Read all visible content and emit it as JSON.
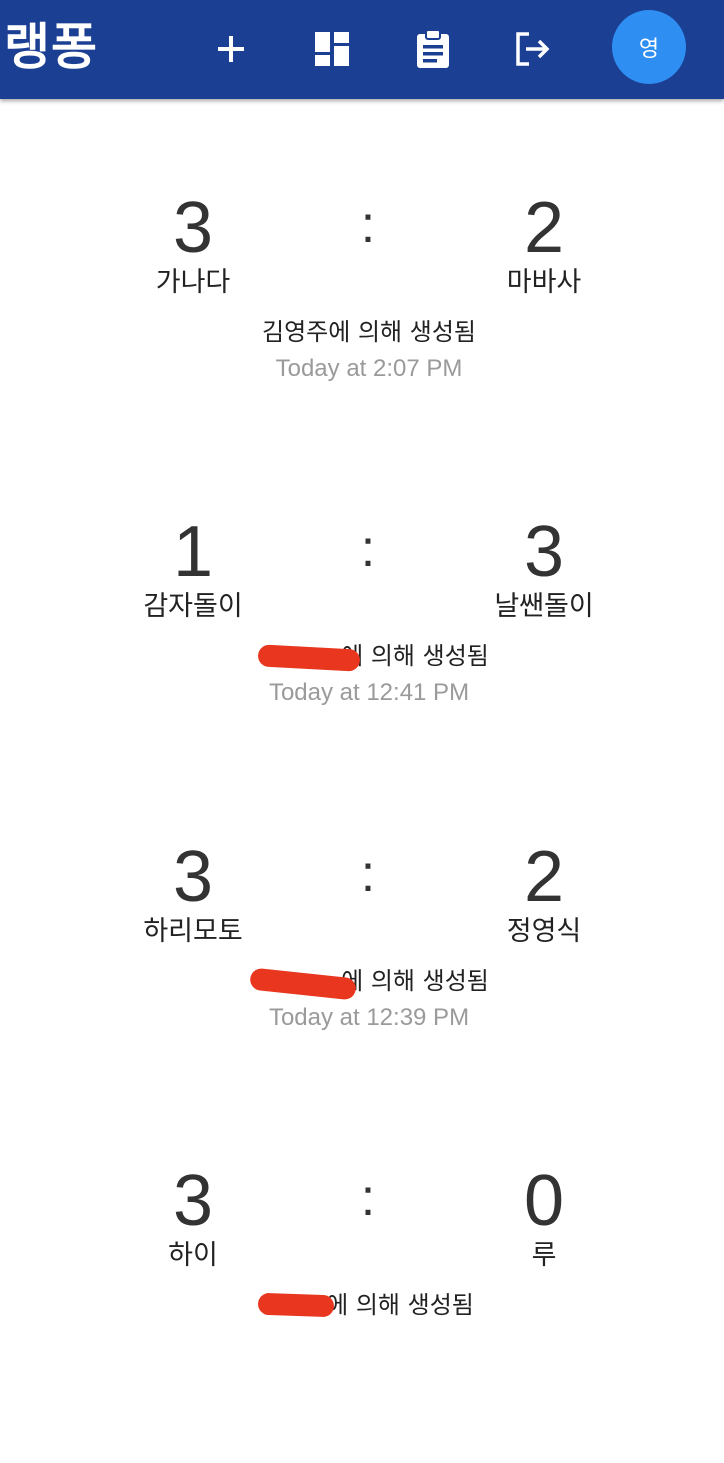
{
  "header": {
    "title": "랭퐁",
    "avatar_letter": "영",
    "icons": [
      "add-icon",
      "dashboard-icon",
      "clipboard-icon",
      "logout-icon"
    ],
    "colors": {
      "bar": "#1a3f93",
      "avatar": "#2f8ef2"
    }
  },
  "matches": [
    {
      "left_score": "3",
      "right_score": "2",
      "left_player": "가나다",
      "right_player": "마바사",
      "creator": "김영주에 의해 생성됨",
      "time": "Today at 2:07 PM"
    },
    {
      "left_score": "1",
      "right_score": "3",
      "left_player": "감자돌이",
      "right_player": "날쌘돌이",
      "creator": "에 의해 생성됨",
      "time": "Today at 12:41 PM"
    },
    {
      "left_score": "3",
      "right_score": "2",
      "left_player": "하리모토",
      "right_player": "정영식",
      "creator": "에 의해 생성됨",
      "time": "Today at 12:39 PM"
    },
    {
      "left_score": "3",
      "right_score": "0",
      "left_player": "하이",
      "right_player": "루",
      "creator": "에 의해 생성됨",
      "time": ""
    }
  ],
  "separator": ":"
}
